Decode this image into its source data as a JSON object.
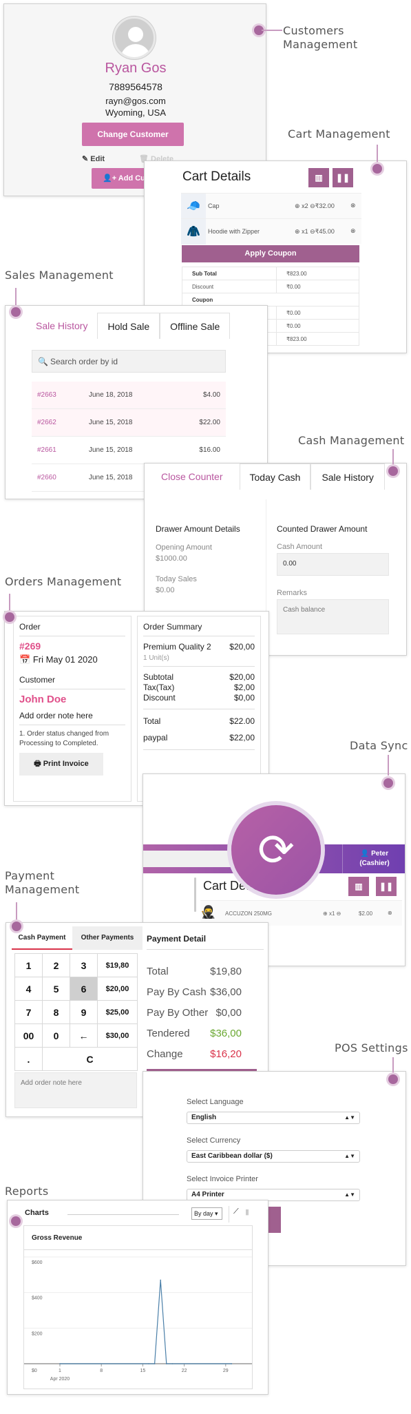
{
  "labels": {
    "customers": [
      "Customers",
      "Management"
    ],
    "cart": "Cart Management",
    "sales": "Sales Management",
    "cash": "Cash Management",
    "orders": "Orders Management",
    "sync": "Data Sync",
    "payment": [
      "Payment",
      "Management"
    ],
    "settings": "POS Settings",
    "reports": "Reports"
  },
  "customer": {
    "name": "Ryan Gos",
    "phone": "7889564578",
    "email": "rayn@gos.com",
    "location": "Wyoming, USA",
    "change_button": "Change Customer",
    "edit": "Edit",
    "delete": "Delete",
    "add_button": "Add Cus"
  },
  "cart": {
    "title": "Cart Details",
    "items": [
      {
        "name": "Cap",
        "qty": "x2",
        "price": "₹32.00",
        "icon": "cap-image"
      },
      {
        "name": "Hoodie with Zipper",
        "qty": "x1",
        "price": "₹45.00",
        "icon": "hoodie-image"
      }
    ],
    "apply_coupon": "Apply Coupon",
    "totals": [
      {
        "label": "Sub Total",
        "value": "₹823.00",
        "bold": true
      },
      {
        "label": "Discount",
        "value": "₹0.00"
      },
      {
        "label": "Coupon",
        "value": "",
        "bold": true
      },
      {
        "label": "",
        "value": "₹0.00"
      },
      {
        "label": "",
        "value": "₹0.00"
      },
      {
        "label": "",
        "value": "₹823.00"
      }
    ]
  },
  "sales": {
    "tabs": [
      "Sale History",
      "Hold Sale",
      "Offline Sale"
    ],
    "search_placeholder": "Search order by id",
    "rows": [
      {
        "id": "#2663",
        "date": "June 18, 2018",
        "amount": "$4.00"
      },
      {
        "id": "#2662",
        "date": "June 15, 2018",
        "amount": "$22.00"
      },
      {
        "id": "#2661",
        "date": "June 15, 2018",
        "amount": "$16.00"
      },
      {
        "id": "#2660",
        "date": "June 15, 2018",
        "amount": ""
      }
    ]
  },
  "cash": {
    "tabs": [
      "Close Counter",
      "Today Cash",
      "Sale History"
    ],
    "drawer_title": "Drawer Amount Details",
    "opening_label": "Opening Amount",
    "opening_value": "$1000.00",
    "today_label": "Today Sales",
    "today_value": "$0.00",
    "counted_title": "Counted Drawer Amount",
    "cash_amount_label": "Cash Amount",
    "cash_amount_value": "0.00",
    "remarks_label": "Remarks",
    "remarks_placeholder": "Cash balance"
  },
  "orders": {
    "order_label": "Order",
    "order_id": "#269",
    "order_date": "Fri May 01 2020",
    "customer_label": "Customer",
    "customer_name": "John Doe",
    "note": "Add order note here",
    "history": "1. Order status changed from Processing to Completed.",
    "print_button": "Print Invoice",
    "summary_title": "Order Summary",
    "item_name": "Premium Quality 2",
    "item_price": "$20,00",
    "item_units": "1 Unit(s)",
    "subtotal_label": "Subtotal",
    "subtotal": "$20,00",
    "tax_label": "Tax(Tax)",
    "tax": "$2,00",
    "discount_label": "Discount",
    "discount": "$0,00",
    "total_label": "Total",
    "total": "$22.00",
    "method_label": "paypal",
    "method_value": "$22,00"
  },
  "sync": {
    "user_name": "Peter",
    "user_role": "(Cashier)",
    "cart_title": "Cart Details",
    "item_name": "ACCUZON 250MG",
    "item_qty": "x1",
    "item_price": "$2.00"
  },
  "payment": {
    "tabs": [
      "Cash Payment",
      "Other Payments"
    ],
    "keypad": [
      [
        "1",
        "2",
        "3",
        "$19,80"
      ],
      [
        "4",
        "5",
        "6",
        "$20,00"
      ],
      [
        "7",
        "8",
        "9",
        "$25,00"
      ],
      [
        "00",
        "0",
        "←",
        "$30,00"
      ]
    ],
    "dot": ".",
    "clear": "C",
    "note_placeholder": "Add order note here",
    "detail_title": "Payment Detail",
    "rows": [
      {
        "label": "Total",
        "value": "$19,80",
        "color": "#555555"
      },
      {
        "label": "Pay By Cash",
        "value": "$36,00",
        "color": "#555555"
      },
      {
        "label": "Pay By Other",
        "value": "$0,00",
        "color": "#555555"
      },
      {
        "label": "Tendered",
        "value": "$36,00",
        "color": "#6aa832"
      },
      {
        "label": "Change",
        "value": "$16,20",
        "color": "#d9334a"
      }
    ]
  },
  "settings": {
    "language_label": "Select Language",
    "language": "English",
    "currency_label": "Select Currency",
    "currency": "East Caribbean dollar ($)",
    "printer_label": "Select Invoice Printer",
    "printer": "A4 Printer"
  },
  "reports": {
    "title": "Charts",
    "period": "By day"
  },
  "chart_data": {
    "type": "line",
    "title": "Gross Revenue",
    "xlabel": "Apr 2020",
    "ylabel": "",
    "x_ticks": [
      "1",
      "8",
      "15",
      "22",
      "29"
    ],
    "y_ticks": [
      "$0",
      "$200",
      "$400",
      "$600"
    ],
    "ylim": [
      0,
      600
    ],
    "xlim": [
      1,
      31
    ],
    "x": [
      1,
      16,
      17,
      18,
      19,
      20,
      30
    ],
    "values": [
      0,
      0,
      0,
      470,
      0,
      0,
      0
    ],
    "grid": true
  },
  "colors": {
    "accent": "#a0608f",
    "pink": "#b9569f",
    "button_pink": "#cf73ac"
  }
}
